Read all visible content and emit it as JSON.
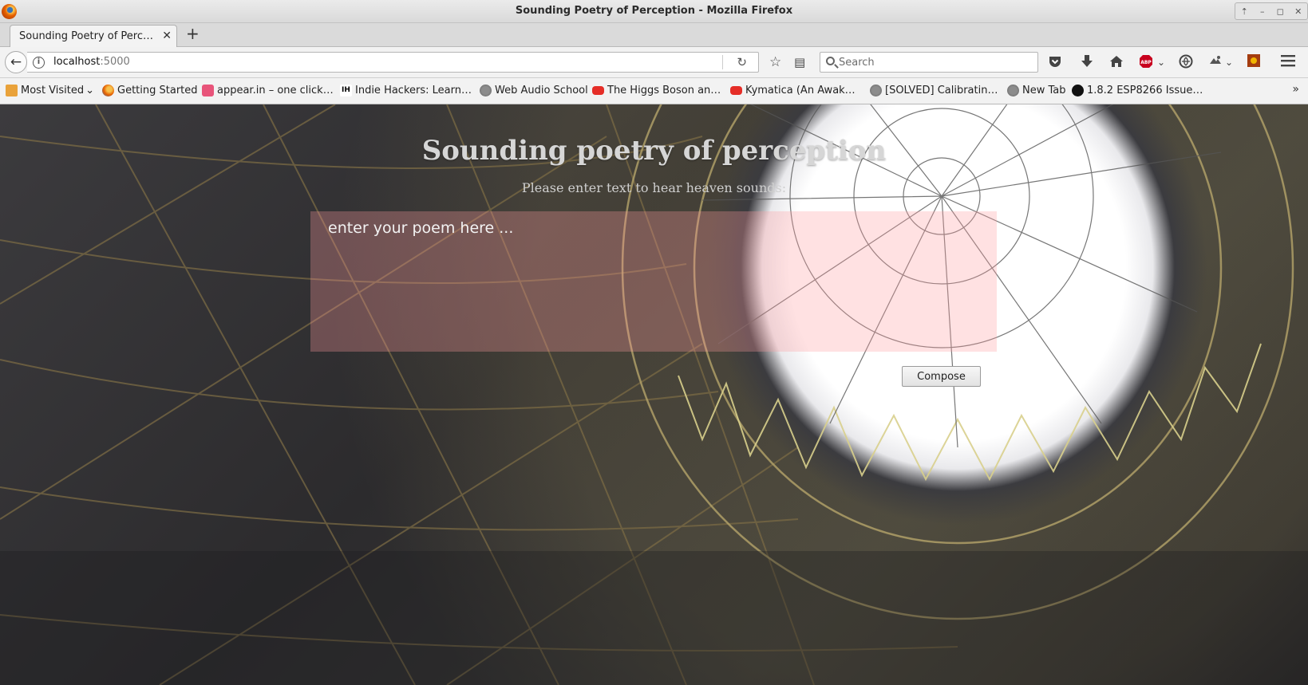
{
  "window": {
    "title": "Sounding Poetry of Perception - Mozilla Firefox",
    "controls": [
      "⇡",
      "–",
      "◻",
      "✕"
    ]
  },
  "tabs": [
    {
      "label": "Sounding Poetry of Perc…",
      "close": "✕"
    }
  ],
  "new_tab_label": "+",
  "navbar": {
    "back": "←",
    "url_host": "localhost",
    "url_port": ":5000",
    "reload": "↻",
    "search_placeholder": "Search",
    "icons": [
      "star-icon",
      "reader-list-icon",
      "pocket-icon",
      "download-icon",
      "home-icon",
      "adblock-icon",
      "extension-icon",
      "extension-icon-2",
      "addon-icon",
      "menu-icon"
    ]
  },
  "bookmarks": [
    {
      "label": "Most Visited",
      "icon": "folder",
      "dropdown": true
    },
    {
      "label": "Getting Started",
      "icon": "firefox"
    },
    {
      "label": "appear.in – one click…",
      "icon": "appear"
    },
    {
      "label": "Indie Hackers: Learn…",
      "icon": "ih"
    },
    {
      "label": "Web Audio School",
      "icon": "globe"
    },
    {
      "label": "The Higgs Boson an…",
      "icon": "youtube"
    },
    {
      "label": "Kymatica (An Awak…",
      "icon": "youtube"
    },
    {
      "label": "[SOLVED] Calibratin…",
      "icon": "globe"
    },
    {
      "label": "New Tab",
      "icon": "globe"
    },
    {
      "label": "1.8.2 ESP8266 Issue…",
      "icon": "github"
    }
  ],
  "bookmarks_more": "»",
  "page": {
    "heading": "Sounding poetry of perception",
    "subheading": "Please enter text to hear heaven sounds:",
    "poem_placeholder": "enter your poem here ...",
    "poem_value": "",
    "compose_label": "Compose"
  }
}
